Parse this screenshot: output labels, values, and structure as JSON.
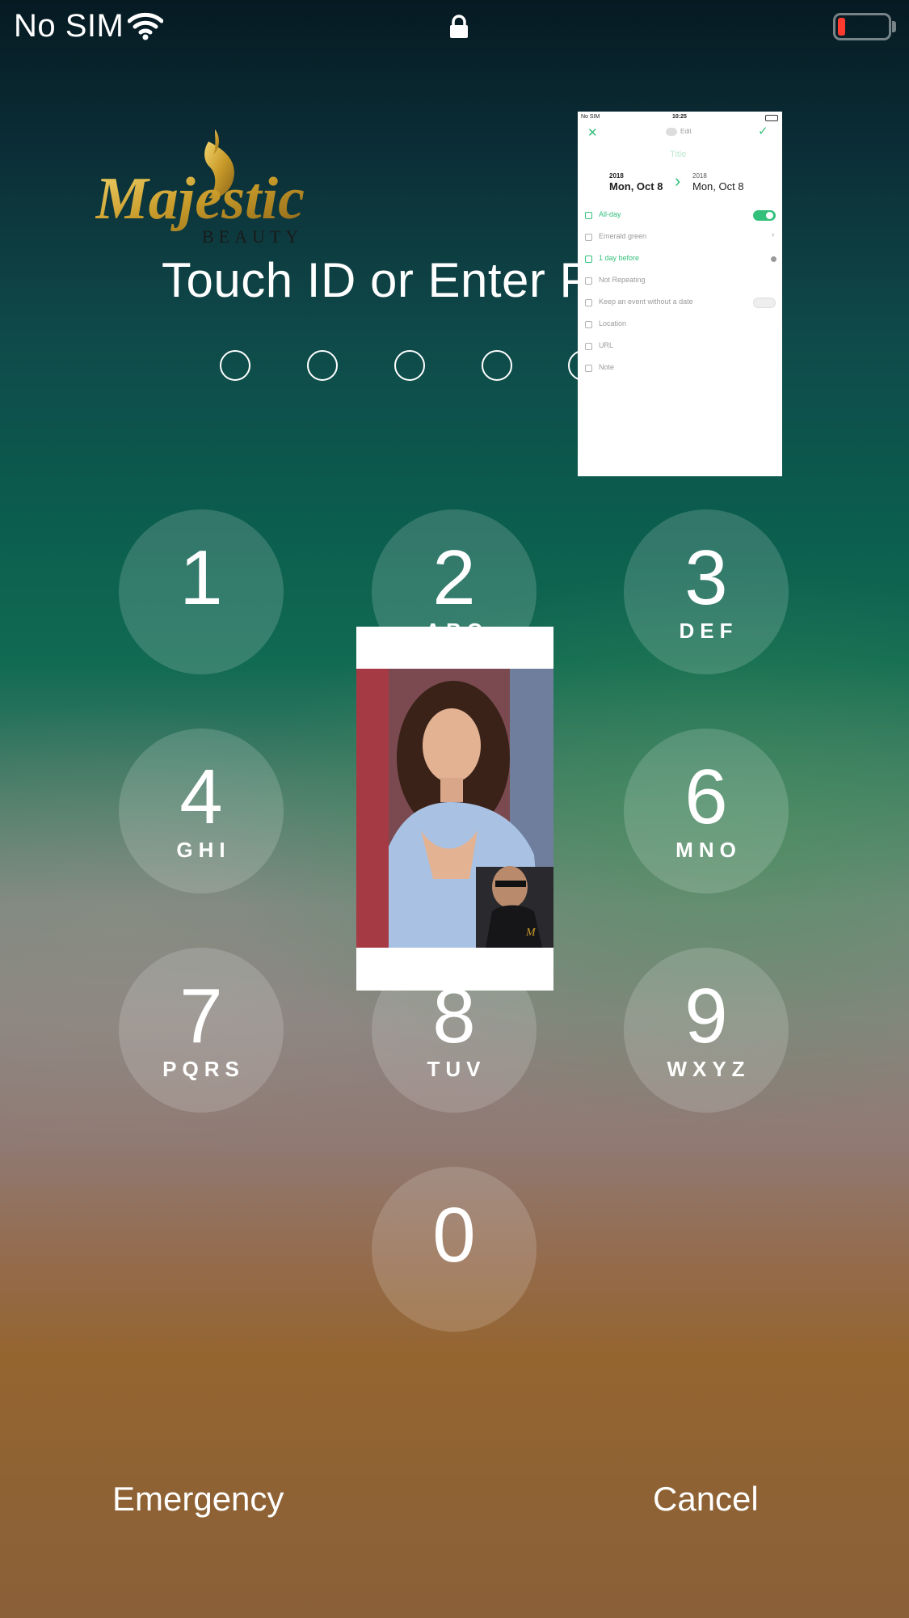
{
  "status_bar": {
    "carrier": "No SIM",
    "battery_color": "#ff3b30"
  },
  "logo": {
    "brand": "Majestic",
    "sub": "BEAUTY"
  },
  "prompt": {
    "text": "Touch ID or Enter Pa"
  },
  "passcode_dots": 5,
  "keypad": {
    "keys": [
      {
        "num": "1",
        "letters": ""
      },
      {
        "num": "2",
        "letters": "ABC"
      },
      {
        "num": "3",
        "letters": "DEF"
      },
      {
        "num": "4",
        "letters": "GHI"
      },
      {
        "num": "6",
        "letters": "MNO"
      },
      {
        "num": "7",
        "letters": "PQRS"
      },
      {
        "num": "8",
        "letters": "TUV"
      },
      {
        "num": "9",
        "letters": "WXYZ"
      },
      {
        "num": "0",
        "letters": ""
      }
    ]
  },
  "buttons": {
    "emergency": "Emergency",
    "cancel": "Cancel"
  },
  "calendar_thumbnail": {
    "carrier": "No SIM",
    "time": "10:25",
    "edit": "Edit",
    "title_placeholder": "Title",
    "start_year": "2018",
    "start_date": "Mon, Oct 8",
    "end_year": "2018",
    "end_date": "Mon, Oct 8",
    "rows": [
      {
        "label": "All-day",
        "icon": "clock-icon"
      },
      {
        "label": "Emerald green",
        "icon": "tag-icon"
      },
      {
        "label": "1 day before",
        "icon": "alarm-icon"
      },
      {
        "label": "Not Repeating",
        "icon": "repeat-icon"
      },
      {
        "label": "Keep an event without a date",
        "icon": "calendar-icon"
      },
      {
        "label": "Location",
        "icon": "pin-icon"
      },
      {
        "label": "URL",
        "icon": "link-icon"
      },
      {
        "label": "Note",
        "icon": "note-icon"
      }
    ],
    "accent_color": "#33c07a"
  }
}
